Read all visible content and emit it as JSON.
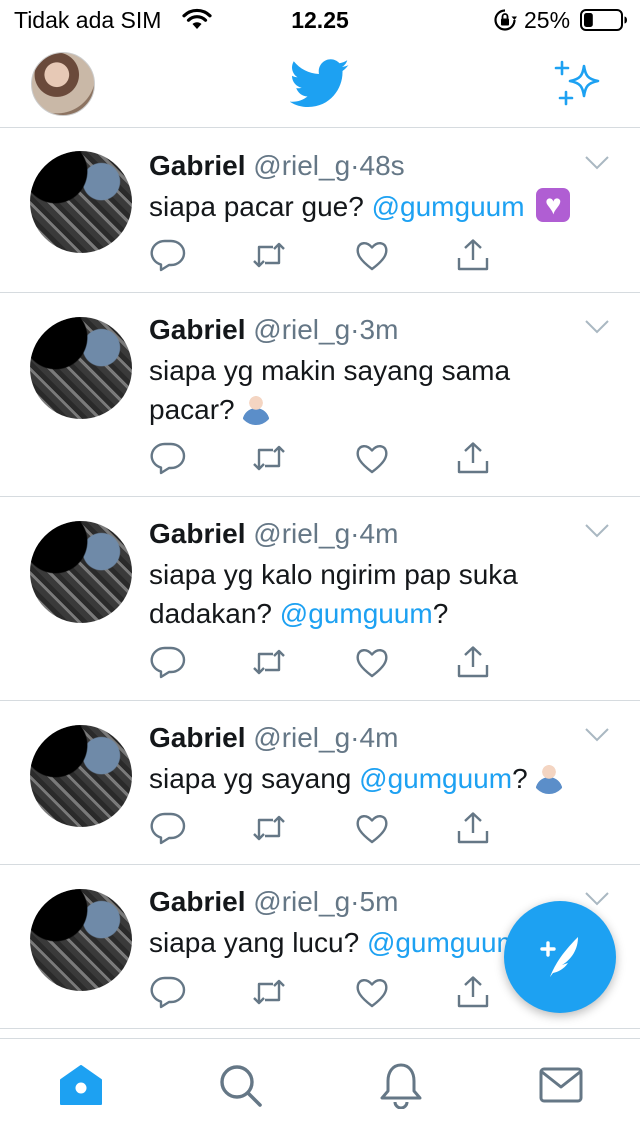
{
  "status_bar": {
    "carrier": "Tidak ada SIM",
    "time": "12.25",
    "battery_percent": "25%",
    "battery_level": 0.25,
    "icons": [
      "wifi-icon",
      "orientation-lock-icon",
      "battery-icon"
    ]
  },
  "nav": {
    "icons": [
      "profile-avatar",
      "twitter-bird-icon",
      "sparkle-icon"
    ]
  },
  "accent_color": "#1da1f2",
  "tweets": [
    {
      "name": "Gabriel",
      "handle": "@riel_g",
      "separator": "·",
      "time": "48s",
      "text_parts": [
        "siapa pacar gue? ",
        "@gumguum",
        ""
      ],
      "emoji": "purple-heart"
    },
    {
      "name": "Gabriel",
      "handle": "@riel_g",
      "separator": "·",
      "time": "3m",
      "text_parts": [
        "siapa yg makin sayang sama pacar?",
        "",
        ""
      ],
      "emoji": "person-raising-hand"
    },
    {
      "name": "Gabriel",
      "handle": "@riel_g",
      "separator": "·",
      "time": "4m",
      "text_parts": [
        "siapa yg kalo ngirim pap suka dadakan? ",
        "@gumguum",
        "?"
      ],
      "emoji": ""
    },
    {
      "name": "Gabriel",
      "handle": "@riel_g",
      "separator": "·",
      "time": "4m",
      "text_parts": [
        "siapa yg sayang ",
        "@gumguum",
        "?"
      ],
      "emoji": "person-raising-hand"
    },
    {
      "name": "Gabriel",
      "handle": "@riel_g",
      "separator": "·",
      "time": "5m",
      "text_parts": [
        "siapa yang lucu? ",
        "@gumguum",
        ""
      ],
      "emoji": ""
    }
  ],
  "tweet_actions": [
    "reply-icon",
    "retweet-icon",
    "like-icon",
    "share-icon"
  ],
  "fab": {
    "icon": "compose-tweet-icon"
  },
  "tab_bar": {
    "tabs": [
      "home-icon",
      "search-icon",
      "notifications-icon",
      "messages-icon"
    ],
    "active": "home-icon"
  }
}
